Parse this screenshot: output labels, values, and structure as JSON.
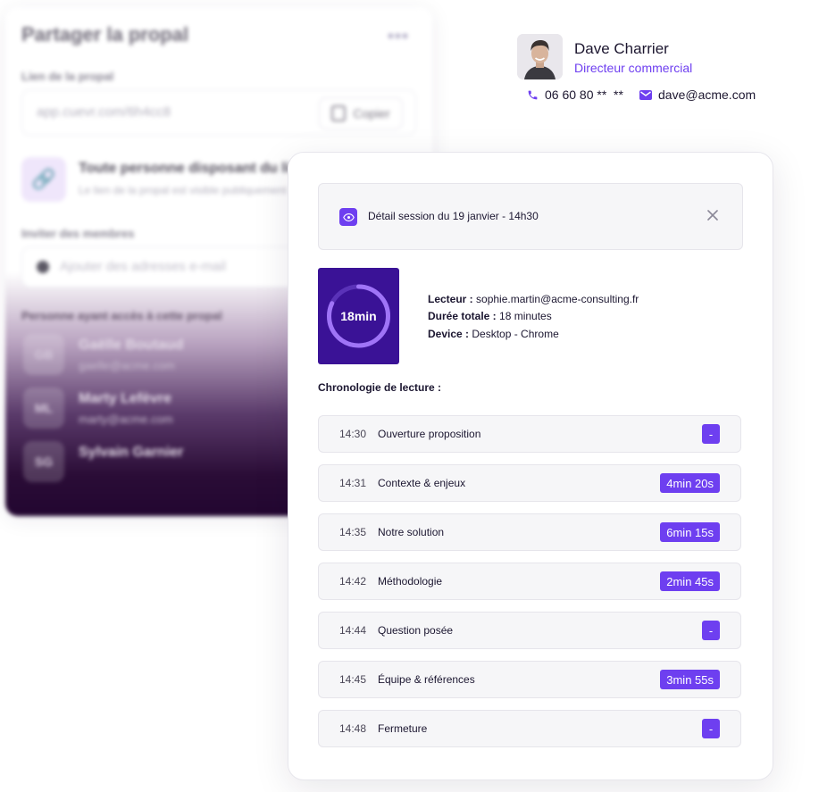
{
  "share_panel": {
    "title": "Partager la propal",
    "more": "•••",
    "link_label": "Lien de la propal",
    "link_value": "app.cuevr.com/6h4cc8",
    "copy_label": "Copier",
    "access_title": "Toute personne disposant du lien",
    "access_desc": "Le lien de la propal est visible publiquement",
    "invite_label": "Inviter des membres",
    "invite_placeholder": "Ajouter des adresses e-mail",
    "members_label": "Personne ayant accès à cette propal",
    "members": [
      {
        "initials": "GB",
        "name": "Gaëlle Boutaud",
        "email": "gaelle@acme.com"
      },
      {
        "initials": "ML",
        "name": "Marty Lefèvre",
        "email": "marty@acme.com"
      },
      {
        "initials": "SG",
        "name": "Sylvain Garnier",
        "email": ""
      }
    ]
  },
  "contact": {
    "name": "Dave Charrier",
    "role": "Directeur commercial",
    "phone": "06 60 80 **  **",
    "email": "dave@acme.com"
  },
  "session": {
    "title": "Détail session du 19 janvier - 14h30",
    "duration_display": "18min",
    "duration_progress": 0.82,
    "reader_label": "Lecteur :",
    "reader_value": "sophie.martin@acme-consulting.fr",
    "total_label": "Durée totale :",
    "total_value": "18 minutes",
    "device_label": "Device :",
    "device_value": "Desktop - Chrome",
    "timeline_title": "Chronologie de lecture :",
    "timeline": [
      {
        "time": "14:30",
        "title": "Ouverture proposition",
        "duration": "-"
      },
      {
        "time": "14:31",
        "title": "Contexte & enjeux",
        "duration": "4min 20s"
      },
      {
        "time": "14:35",
        "title": "Notre solution",
        "duration": "6min 15s"
      },
      {
        "time": "14:42",
        "title": "Méthodologie",
        "duration": "2min 45s"
      },
      {
        "time": "14:44",
        "title": "Question posée",
        "duration": "-"
      },
      {
        "time": "14:45",
        "title": "Équipe & références",
        "duration": "3min 55s"
      },
      {
        "time": "14:48",
        "title": "Fermeture",
        "duration": "-"
      }
    ]
  },
  "colors": {
    "accent": "#6e3ff0",
    "tile_bg": "#3a1296"
  }
}
